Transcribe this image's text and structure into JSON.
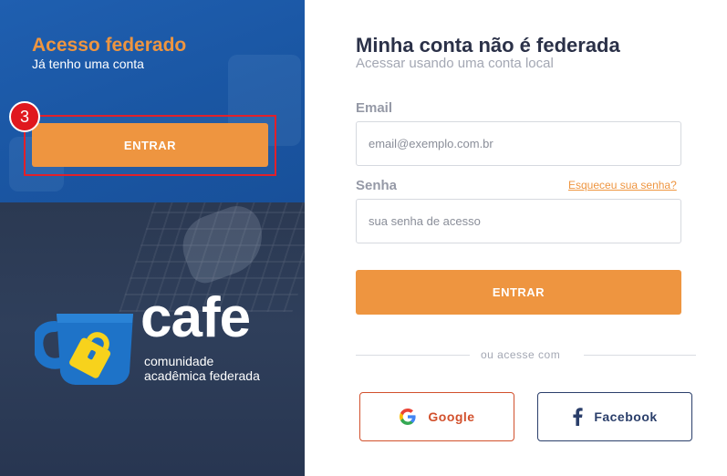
{
  "federated": {
    "title": "Acesso federado",
    "subtitle": "Já tenho uma conta",
    "enter_label": "ENTRAR",
    "step_badge": "3"
  },
  "brand": {
    "name": "cafe",
    "tagline_line1": "comunidade",
    "tagline_line2": "acadêmica federada"
  },
  "local": {
    "title": "Minha conta não é federada",
    "subtitle": "Acessar usando uma conta local",
    "email_label": "Email",
    "email_placeholder": "email@exemplo.com.br",
    "password_label": "Senha",
    "password_placeholder": "sua senha de acesso",
    "forgot_label": "Esqueceu sua senha?",
    "enter_label": "ENTRAR",
    "divider_text": "ou acesse com",
    "google_label": "Google",
    "facebook_label": "Facebook"
  },
  "colors": {
    "accent": "#ee9540",
    "federated_blue": "#1a56a3",
    "dark_navy": "#2b3952",
    "highlight_red": "#e2202a",
    "google_red": "#d2502c",
    "facebook_navy": "#2b3f6b"
  },
  "icons": {
    "logo": "coffee-cup-lock-icon",
    "google": "google-icon",
    "facebook": "facebook-icon"
  }
}
